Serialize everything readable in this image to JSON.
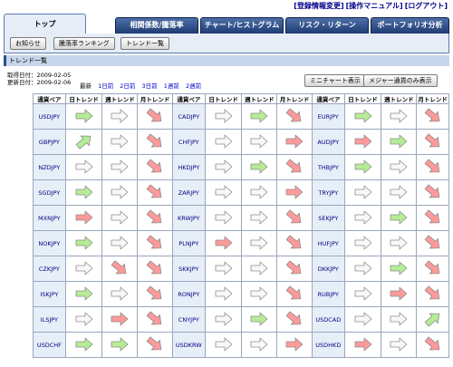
{
  "top_links": [
    "[登録情報変更]",
    "[操作マニュアル]",
    "[ログアウト]"
  ],
  "tabs": [
    {
      "label": "トップ",
      "active": true
    },
    {
      "label": "相関係数/騰落率",
      "active": false
    },
    {
      "label": "チャート/ヒストグラム",
      "active": false
    },
    {
      "label": "リスク・リターン",
      "active": false
    },
    {
      "label": "ポートフォリオ分析",
      "active": false
    }
  ],
  "subnav": [
    "お知らせ",
    "騰落率ランキング",
    "トレンド一覧"
  ],
  "page_title": "トレンド一覧",
  "dates": {
    "fetched": "取得日付：2009-02-05",
    "updated": "更新日付：2009-02-06"
  },
  "periods": [
    "最新",
    "1日前",
    "2日前",
    "3日前",
    "1週前",
    "2週前"
  ],
  "buttons": {
    "mini_chart": "ミニチャート表示",
    "major_only": "メジャー通貨のみ表示"
  },
  "table": {
    "headers": [
      "通貨ペア",
      "日トレンド",
      "週トレンド",
      "月トレンド",
      "通貨ペア",
      "日トレンド",
      "週トレンド",
      "月トレンド",
      "通貨ペア",
      "日トレンド",
      "週トレンド",
      "月トレンド"
    ],
    "rows": [
      [
        [
          "USDJPY",
          "right-green",
          "right-white",
          "down-red"
        ],
        [
          "CADJPY",
          "right-white",
          "right-green",
          "down-red"
        ],
        [
          "EURJPY",
          "right-green",
          "right-white",
          "down-red"
        ]
      ],
      [
        [
          "GBPJPY",
          "up-green",
          "right-white",
          "down-red"
        ],
        [
          "CHFJPY",
          "right-white",
          "right-white",
          "right-red"
        ],
        [
          "AUDJPY",
          "right-red",
          "right-green",
          "down-red"
        ]
      ],
      [
        [
          "NZDJPY",
          "right-white",
          "right-white",
          "down-red"
        ],
        [
          "HKDJPY",
          "right-white",
          "right-green",
          "down-red"
        ],
        [
          "THBJPY",
          "right-green",
          "right-white",
          "down-red"
        ]
      ],
      [
        [
          "SGDJPY",
          "right-green",
          "right-white",
          "down-red"
        ],
        [
          "ZARJPY",
          "right-white",
          "right-white",
          "right-red"
        ],
        [
          "TRYJPY",
          "right-white",
          "right-white",
          "down-red"
        ]
      ],
      [
        [
          "MXNJPY",
          "right-red",
          "right-white",
          "down-red"
        ],
        [
          "KRWJPY",
          "right-white",
          "right-white",
          "down-red"
        ],
        [
          "SEKJPY",
          "right-white",
          "right-green",
          "down-red"
        ]
      ],
      [
        [
          "NOKJPY",
          "right-green",
          "right-white",
          "down-red"
        ],
        [
          "PLNJPY",
          "right-red",
          "right-white",
          "down-red"
        ],
        [
          "HUFJPY",
          "right-white",
          "right-white",
          "down-red"
        ]
      ],
      [
        [
          "CZKJPY",
          "right-white",
          "down-red",
          "down-red"
        ],
        [
          "SKKJPY",
          "right-white",
          "right-white",
          "down-red"
        ],
        [
          "DKKJPY",
          "right-white",
          "right-green",
          "down-red"
        ]
      ],
      [
        [
          "ISKJPY",
          "right-green",
          "right-white",
          "down-red"
        ],
        [
          "RONJPY",
          "right-white",
          "right-white",
          "down-red"
        ],
        [
          "RUBJPY",
          "right-white",
          "right-red",
          "down-red"
        ]
      ],
      [
        [
          "ILSJPY",
          "right-white",
          "right-red",
          "down-red"
        ],
        [
          "CNYJPY",
          "right-white",
          "right-green",
          "down-red"
        ],
        [
          "USDCAD",
          "right-white",
          "right-white",
          "up-green"
        ]
      ],
      [
        [
          "USDCHF",
          "right-green",
          "right-green",
          "down-red"
        ],
        [
          "USDKRW",
          "right-white",
          "right-white",
          "right-red"
        ],
        [
          "USDHKD",
          "right-red",
          "right-white",
          "down-red"
        ]
      ]
    ]
  },
  "colors": {
    "tab_dark": "#1f3b73",
    "tab_active": "#e6edf7",
    "pair_bg": "#e6eef8",
    "arrow_green": "#b5ec95",
    "arrow_red": "#ff9a9a",
    "arrow_white": "#f8f8f8",
    "link": "#00008b"
  },
  "icons": {
    "right-green": "right-arrow-green-icon",
    "right-white": "right-arrow-white-icon",
    "right-red": "right-arrow-red-icon",
    "down-red": "down-arrow-red-icon",
    "up-green": "up-arrow-green-icon"
  }
}
